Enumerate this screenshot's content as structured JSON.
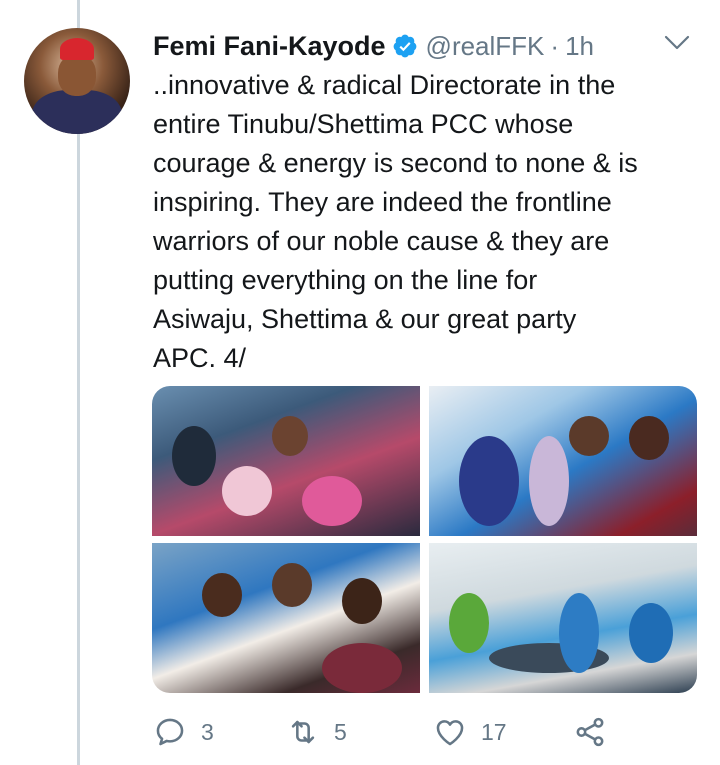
{
  "tweet": {
    "author_name": "Femi Fani-Kayode",
    "handle": "@realFFK",
    "separator": "·",
    "time": "1h",
    "text": "..innovative & radical Directorate in the\nentire Tinubu/Shettima PCC whose\ncourage & energy is second to none & is\ninspiring. They are indeed the frontline\nwarriors of our noble cause & they are\nputting everything on the line for\nAsiwaju, Shettima & our great party\nAPC. 4/",
    "media_count": 4,
    "replies": "3",
    "retweets": "5",
    "likes": "17"
  },
  "colors": {
    "verified_badge": "#1da1f2",
    "secondary_text": "#657786",
    "thread_line": "#ccd6dd"
  },
  "icons": [
    "verified-badge-icon",
    "chevron-down-icon",
    "reply-icon",
    "retweet-icon",
    "like-icon",
    "share-icon"
  ]
}
